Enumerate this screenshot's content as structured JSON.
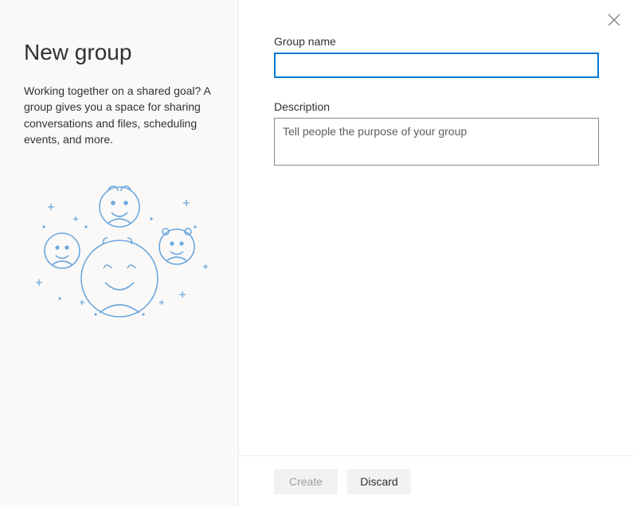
{
  "sidebar": {
    "title": "New group",
    "description": "Working together on a shared goal? A group gives you a space for sharing conversations and files, scheduling events, and more."
  },
  "form": {
    "groupNameLabel": "Group name",
    "groupNameValue": "",
    "descriptionLabel": "Description",
    "descriptionPlaceholder": "Tell people the purpose of your group",
    "descriptionValue": ""
  },
  "footer": {
    "createLabel": "Create",
    "discardLabel": "Discard"
  }
}
